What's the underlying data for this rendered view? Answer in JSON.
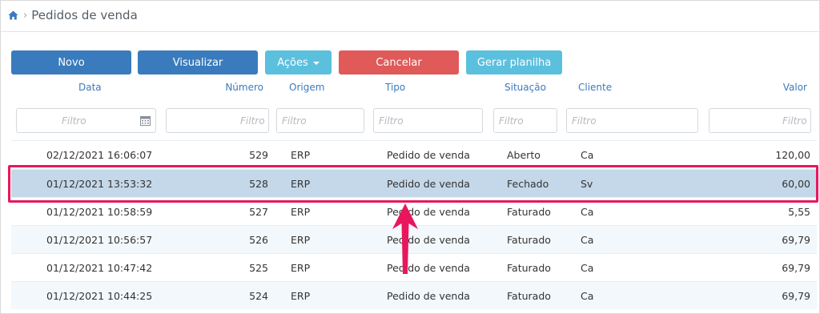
{
  "breadcrumb": {
    "home_icon": "home-icon",
    "title": "Pedidos de venda"
  },
  "toolbar": {
    "novo": "Novo",
    "visualizar": "Visualizar",
    "acoes": "Ações",
    "cancelar": "Cancelar",
    "gerar_planilha": "Gerar planilha"
  },
  "columns": {
    "data": "Data",
    "numero": "Número",
    "origem": "Origem",
    "tipo": "Tipo",
    "situacao": "Situação",
    "cliente": "Cliente",
    "valor": "Valor"
  },
  "filters": {
    "placeholder": "Filtro"
  },
  "rows": [
    {
      "data": "02/12/2021 16:06:07",
      "numero": "529",
      "origem": "ERP",
      "tipo": "Pedido de venda",
      "situacao": "Aberto",
      "cliente": "Ca",
      "valor": "120,00"
    },
    {
      "data": "01/12/2021 13:53:32",
      "numero": "528",
      "origem": "ERP",
      "tipo": "Pedido de venda",
      "situacao": "Fechado",
      "cliente": "Sv",
      "valor": "60,00"
    },
    {
      "data": "01/12/2021 10:58:59",
      "numero": "527",
      "origem": "ERP",
      "tipo": "Pedido de venda",
      "situacao": "Faturado",
      "cliente": "Ca",
      "valor": "5,55"
    },
    {
      "data": "01/12/2021 10:56:57",
      "numero": "526",
      "origem": "ERP",
      "tipo": "Pedido de venda",
      "situacao": "Faturado",
      "cliente": "Ca",
      "valor": "69,79"
    },
    {
      "data": "01/12/2021 10:47:42",
      "numero": "525",
      "origem": "ERP",
      "tipo": "Pedido de venda",
      "situacao": "Faturado",
      "cliente": "Ca",
      "valor": "69,79"
    },
    {
      "data": "01/12/2021 10:44:25",
      "numero": "524",
      "origem": "ERP",
      "tipo": "Pedido de venda",
      "situacao": "Faturado",
      "cliente": "Ca",
      "valor": "69,79"
    }
  ],
  "selected_row_index": 1,
  "annotation": {
    "highlight_color": "#e8175d",
    "arrow_icon": "up-arrow-icon"
  },
  "colors": {
    "primary": "#3a7bbd",
    "info": "#5bc0de",
    "danger": "#e05a5a",
    "selected_row": "#c4d8ea"
  }
}
